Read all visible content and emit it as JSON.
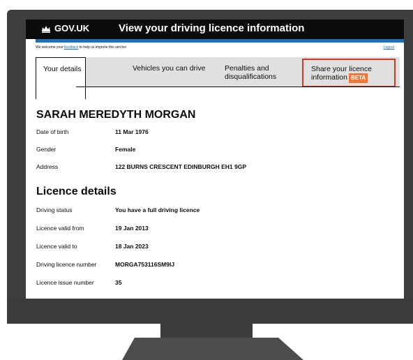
{
  "header": {
    "logo_text": "GOV.UK",
    "title": "View your driving licence information"
  },
  "feedback": {
    "prefix": "We welcome your",
    "link": "feedback",
    "suffix": "to help us improve this service",
    "logout": "Logout"
  },
  "tabs": [
    {
      "label": "Your details",
      "active": true
    },
    {
      "label": "Vehicles you can drive",
      "active": false
    },
    {
      "label": "Penalties and disqualifications",
      "active": false
    },
    {
      "label": "Share your licence information",
      "badge": "BETA",
      "active": false
    }
  ],
  "person": {
    "name": "SARAH MEREDYTH MORGAN",
    "fields": [
      {
        "label": "Date of birth",
        "value": "11 Mar 1976"
      },
      {
        "label": "Gender",
        "value": "Female"
      },
      {
        "label": "Address",
        "value": "122 BURNS CRESCENT EDINBURGH EH1 9GP"
      }
    ]
  },
  "licence": {
    "title": "Licence details",
    "fields": [
      {
        "label": "Driving status",
        "value": "You have a full driving licence"
      },
      {
        "label": "Licence valid from",
        "value": "19 Jan 2013"
      },
      {
        "label": "Licence valid to",
        "value": "18 Jan 2023"
      },
      {
        "label": "Driving licence number",
        "value": "MORGA753116SM9IJ"
      },
      {
        "label": "Licence issue number",
        "value": "35"
      }
    ]
  },
  "colors": {
    "header_bg": "#0b0c0c",
    "accent_blue": "#1d70b8",
    "beta_orange": "#f47738",
    "highlight_red": "#d4351c"
  }
}
